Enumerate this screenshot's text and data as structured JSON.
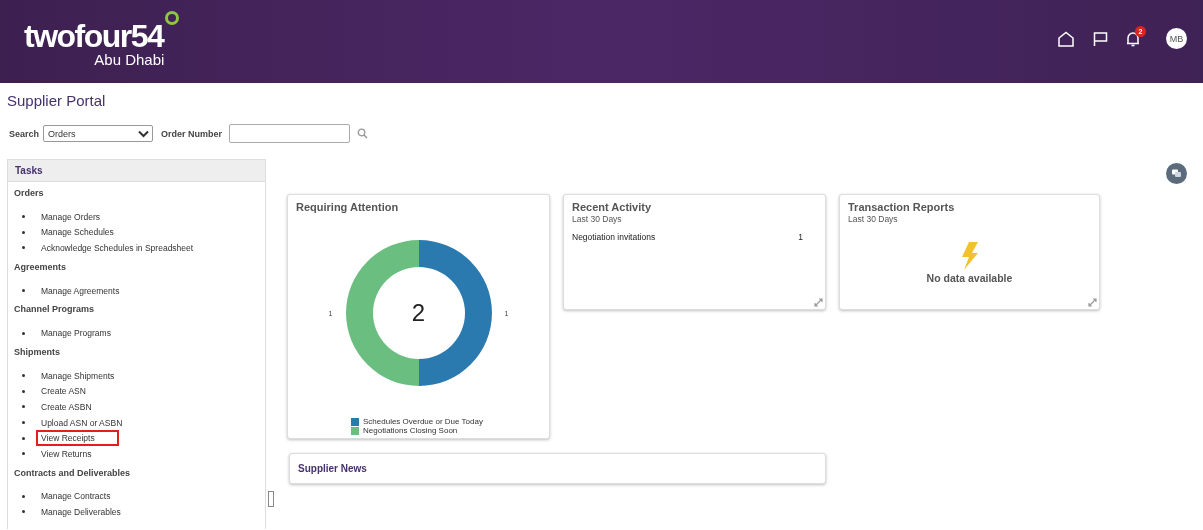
{
  "header": {
    "logo": "twofour54",
    "logo_sub": "Abu Dhabi",
    "notification_count": "2",
    "avatar": "MB"
  },
  "page_title": "Supplier Portal",
  "search": {
    "label": "Search",
    "value": "Orders",
    "order_label": "Order Number"
  },
  "tasks": {
    "title": "Tasks",
    "sections": [
      {
        "title": "Orders",
        "items": [
          {
            "label": "Manage Orders",
            "highlighted": false
          },
          {
            "label": "Manage Schedules",
            "highlighted": false
          },
          {
            "label": "Acknowledge Schedules in Spreadsheet",
            "highlighted": false
          }
        ]
      },
      {
        "title": "Agreements",
        "items": [
          {
            "label": "Manage Agreements",
            "highlighted": false
          }
        ]
      },
      {
        "title": "Channel Programs",
        "items": [
          {
            "label": "Manage Programs",
            "highlighted": false
          }
        ]
      },
      {
        "title": "Shipments",
        "items": [
          {
            "label": "Manage Shipments",
            "highlighted": false
          },
          {
            "label": "Create ASN",
            "highlighted": false
          },
          {
            "label": "Create ASBN",
            "highlighted": false
          },
          {
            "label": "Upload ASN or ASBN",
            "highlighted": false
          },
          {
            "label": "View Receipts",
            "highlighted": true
          },
          {
            "label": "View Returns",
            "highlighted": false
          }
        ]
      },
      {
        "title": "Contracts and Deliverables",
        "items": [
          {
            "label": "Manage Contracts",
            "highlighted": false
          },
          {
            "label": "Manage Deliverables",
            "highlighted": false
          }
        ]
      }
    ]
  },
  "requiring_attention": {
    "title": "Requiring Attention",
    "total": "2",
    "chart_data": {
      "type": "donut",
      "categories": [
        "Schedules Overdue or Due Today",
        "Negotiations Closing Soon"
      ],
      "values": [
        1,
        1
      ],
      "colors": [
        "#2a7ab0",
        "#6abf80"
      ],
      "value_labels": [
        "1",
        "1"
      ]
    }
  },
  "recent_activity": {
    "title": "Recent Activity",
    "subtitle": "Last 30 Days",
    "rows": [
      {
        "label": "Negotiation invitations",
        "count": "1"
      }
    ]
  },
  "transaction_reports": {
    "title": "Transaction Reports",
    "subtitle": "Last 30 Days",
    "empty_text": "No data available"
  },
  "supplier_news": {
    "title": "Supplier News"
  }
}
